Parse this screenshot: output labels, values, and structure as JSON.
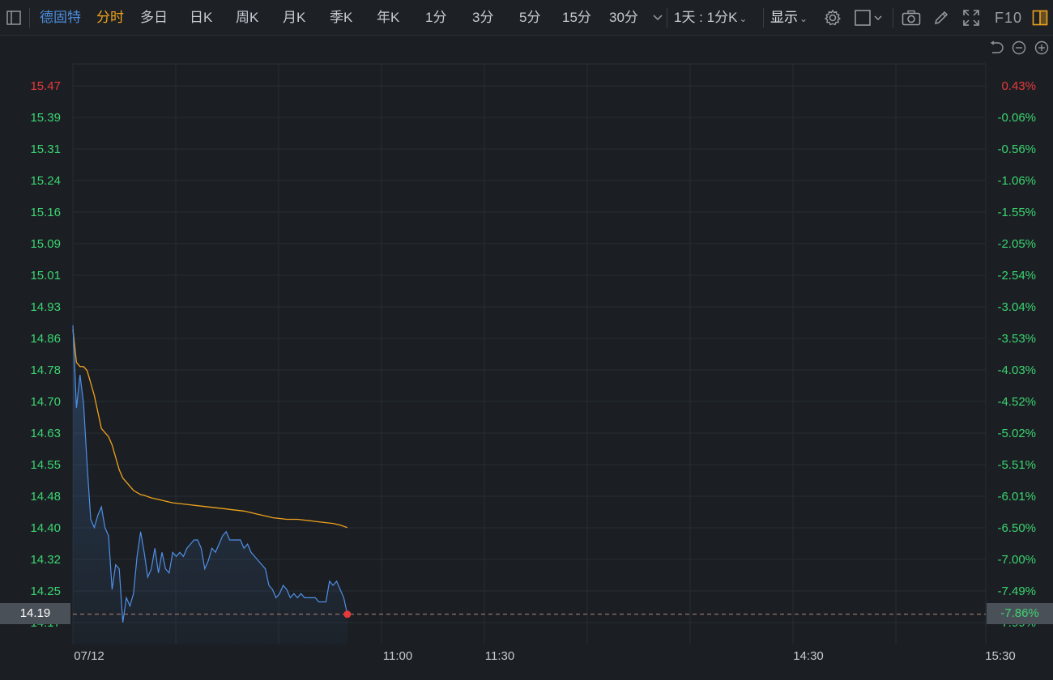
{
  "toolbar": {
    "stock_name": "德固特",
    "periods": [
      {
        "label": "分时",
        "active": true
      },
      {
        "label": "多日",
        "active": false
      },
      {
        "label": "日K",
        "active": false
      },
      {
        "label": "周K",
        "active": false
      },
      {
        "label": "月K",
        "active": false
      },
      {
        "label": "季K",
        "active": false
      },
      {
        "label": "年K",
        "active": false
      },
      {
        "label": "1分",
        "active": false
      },
      {
        "label": "3分",
        "active": false
      },
      {
        "label": "5分",
        "active": false
      },
      {
        "label": "15分",
        "active": false
      },
      {
        "label": "30分",
        "active": false
      }
    ],
    "range_select": "1天 : 1分K",
    "display_menu": "显示",
    "f10": "F10",
    "icons": [
      "layout-toggle-icon",
      "chevron-down-icon",
      "settings-gear-icon",
      "square-shape-icon",
      "camera-icon",
      "pencil-draw-icon",
      "fullscreen-icon",
      "panel-toggle-icon",
      "undo-icon",
      "zoom-out-icon",
      "zoom-in-icon"
    ]
  },
  "colors": {
    "price_line": "#4f8fe6",
    "avg_line": "#f0a21b",
    "up": "#e8393a",
    "down": "#3bd46f",
    "active_tab": "#f0a21b",
    "stock_name": "#4c8dde"
  },
  "tags": {
    "price": "14.19",
    "pct": "-7.86%"
  },
  "chart_data": {
    "type": "line",
    "title": "",
    "date_label": "07/12",
    "x_ticks": [
      "07/12",
      "11:00",
      "11:30",
      "14:30",
      "15:30"
    ],
    "y_ticks_left": [
      "15.47",
      "15.39",
      "15.31",
      "15.24",
      "15.16",
      "15.09",
      "15.01",
      "14.93",
      "14.86",
      "14.78",
      "14.70",
      "14.63",
      "14.55",
      "14.48",
      "14.40",
      "14.32",
      "14.25",
      "14.17"
    ],
    "y_ticks_right": [
      "0.43%",
      "-0.06%",
      "-0.56%",
      "-1.06%",
      "-1.55%",
      "-2.05%",
      "-2.54%",
      "-3.04%",
      "-3.53%",
      "-4.03%",
      "-4.52%",
      "-5.02%",
      "-5.51%",
      "-6.01%",
      "-6.50%",
      "-7.00%",
      "-7.49%",
      "-7.99%"
    ],
    "ylim": [
      14.17,
      15.47
    ],
    "last_price": 14.19,
    "series": [
      {
        "label": "price",
        "values": [
          14.89,
          14.69,
          14.77,
          14.7,
          14.55,
          14.42,
          14.4,
          14.43,
          14.45,
          14.4,
          14.38,
          14.25,
          14.31,
          14.3,
          14.17,
          14.23,
          14.21,
          14.24,
          14.33,
          14.39,
          14.34,
          14.28,
          14.3,
          14.35,
          14.29,
          14.34,
          14.3,
          14.29,
          14.34,
          14.33,
          14.34,
          14.33,
          14.35,
          14.36,
          14.37,
          14.37,
          14.35,
          14.3,
          14.32,
          14.35,
          14.34,
          14.36,
          14.38,
          14.39,
          14.37,
          14.37,
          14.37,
          14.37,
          14.35,
          14.36,
          14.34,
          14.33,
          14.32,
          14.31,
          14.3,
          14.26,
          14.25,
          14.23,
          14.24,
          14.26,
          14.25,
          14.23,
          14.24,
          14.23,
          14.24,
          14.23,
          14.23,
          14.23,
          14.23,
          14.22,
          14.22,
          14.22,
          14.27,
          14.26,
          14.27,
          14.25,
          14.23,
          14.19
        ]
      },
      {
        "label": "average",
        "values": [
          14.88,
          14.8,
          14.79,
          14.79,
          14.78,
          14.75,
          14.72,
          14.68,
          14.64,
          14.63,
          14.62,
          14.6,
          14.57,
          14.54,
          14.52,
          14.51,
          14.5,
          14.49,
          14.485,
          14.48,
          14.478,
          14.475,
          14.472,
          14.47,
          14.468,
          14.466,
          14.464,
          14.462,
          14.46,
          14.459,
          14.458,
          14.457,
          14.456,
          14.455,
          14.454,
          14.453,
          14.452,
          14.451,
          14.45,
          14.449,
          14.448,
          14.447,
          14.446,
          14.445,
          14.444,
          14.443,
          14.442,
          14.441,
          14.44,
          14.438,
          14.436,
          14.434,
          14.432,
          14.43,
          14.428,
          14.426,
          14.424,
          14.423,
          14.422,
          14.421,
          14.42,
          14.42,
          14.42,
          14.42,
          14.419,
          14.418,
          14.417,
          14.416,
          14.415,
          14.414,
          14.413,
          14.412,
          14.411,
          14.41,
          14.408,
          14.406,
          14.403,
          14.4
        ]
      }
    ]
  }
}
